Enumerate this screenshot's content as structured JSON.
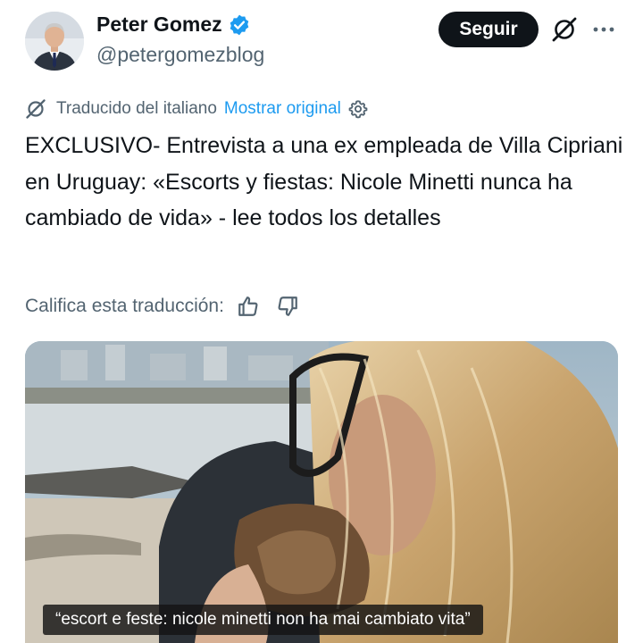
{
  "author": {
    "display_name": "Peter Gomez",
    "handle": "@petergomezblog",
    "verified": true
  },
  "actions": {
    "follow_label": "Seguir",
    "grok_icon": "grok-icon",
    "more_icon": "more-options-icon"
  },
  "translation": {
    "notice": "Traducido del italiano",
    "show_original": "Mostrar original",
    "settings_icon": "gear-icon"
  },
  "tweet": {
    "text": "EXCLUSIVO- Entrevista a una ex empleada de Villa Cipriani en Uruguay: «Escorts y fiestas: Nicole Minetti nunca ha cambiado de vida» - lee todos los detalles"
  },
  "rating": {
    "prompt": "Califica esta traducción:",
    "like_icon": "thumbs-up-icon",
    "dislike_icon": "thumbs-down-icon"
  },
  "media": {
    "caption": "“escort e feste: nicole minetti non ha mai cambiato vita”"
  },
  "colors": {
    "text": "#0f1419",
    "secondary": "#536471",
    "link": "#1d9bf0",
    "verified": "#1d9bf0",
    "button_bg": "#0f1419"
  }
}
